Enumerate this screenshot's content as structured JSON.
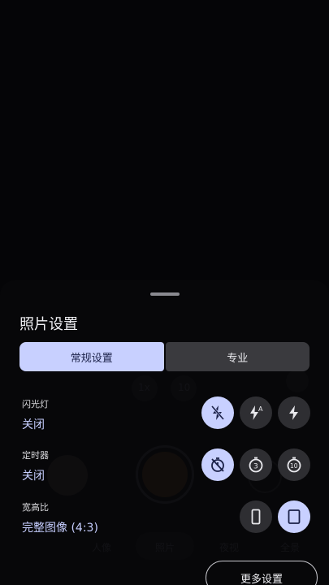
{
  "sheet": {
    "title": "照片设置",
    "tabs": [
      {
        "label": "常规设置",
        "active": true
      },
      {
        "label": "专业",
        "active": false
      }
    ],
    "settings": {
      "flash": {
        "label": "闪光灯",
        "value": "关闭",
        "options": [
          "flash-off-icon",
          "flash-auto-icon",
          "flash-on-icon"
        ],
        "selected": 0
      },
      "timer": {
        "label": "定时器",
        "value": "关闭",
        "options": [
          "timer-off-icon",
          "timer-3s-icon",
          "timer-10s-icon"
        ],
        "selected": 0
      },
      "aspect": {
        "label": "宽高比",
        "value": "完整图像 (4:3)",
        "options": [
          "aspect-portrait-9-16-icon",
          "aspect-4-3-icon"
        ],
        "selected": 1
      }
    },
    "more_settings": "更多设置"
  },
  "background_modes": [
    "人像",
    "照片",
    "夜视",
    "全景"
  ],
  "background_zoom": [
    "1x",
    "10"
  ],
  "colors": {
    "accent": "#c8d0ff",
    "accent_text": "#1b2148",
    "chip": "#2e2e32"
  }
}
